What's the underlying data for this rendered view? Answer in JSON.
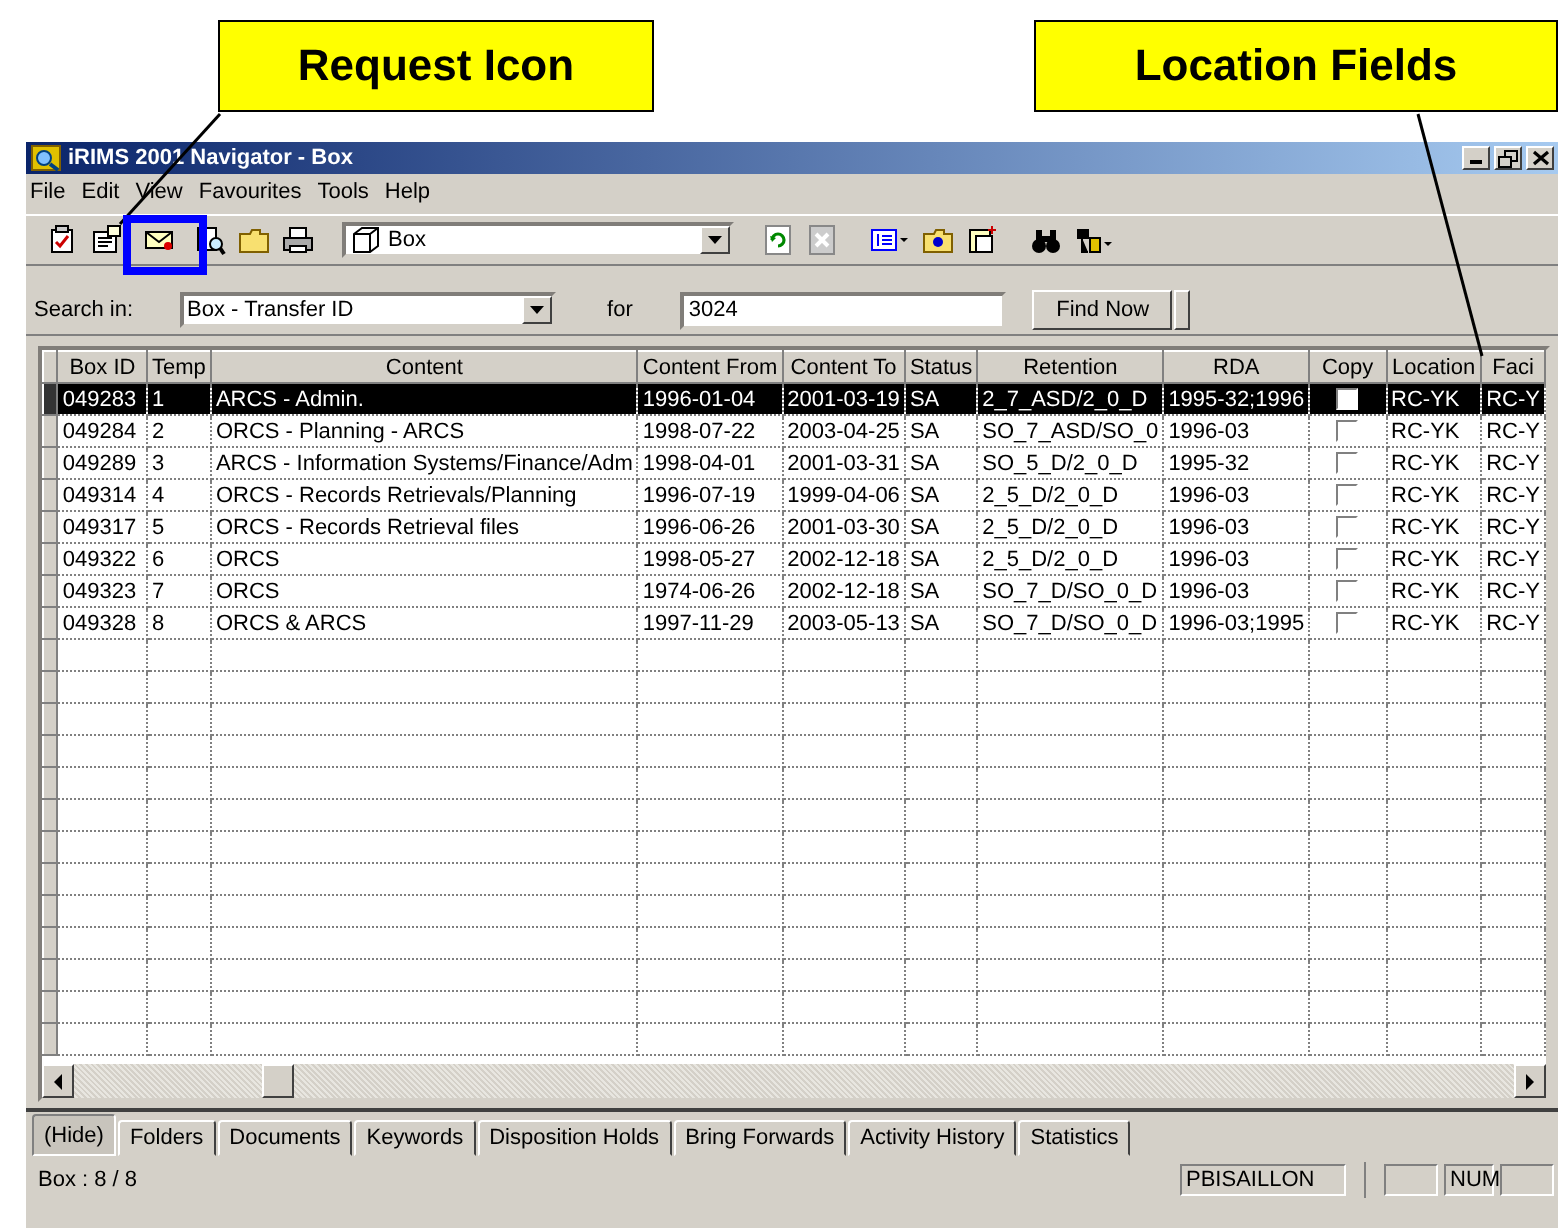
{
  "callouts": [
    {
      "text": "Request Icon"
    },
    {
      "text": "Location Fields"
    }
  ],
  "window": {
    "title": "iRIMS 2001 Navigator - Box"
  },
  "menu": [
    "File",
    "Edit",
    "View",
    "Favourites",
    "Tools",
    "Help"
  ],
  "toolbar": {
    "view_value": "Box"
  },
  "search": {
    "label": "Search in:",
    "field": "Box - Transfer ID",
    "for_label": "for",
    "query": "3024",
    "button": "Find Now"
  },
  "table": {
    "columns": [
      "Box ID",
      "Temp",
      "Content",
      "Content From",
      "Content To",
      "Status",
      "Retention",
      "RDA",
      "Copy",
      "Location",
      "Faci"
    ],
    "rows": [
      {
        "selected": true,
        "copy": false,
        "cells": [
          "049283",
          "1",
          "ARCS - Admin.",
          "1996-01-04",
          "2001-03-19",
          "SA",
          "2_7_ASD/2_0_D",
          "1995-32;1996",
          "",
          "RC-YK",
          "RC-Y"
        ]
      },
      {
        "selected": false,
        "copy": false,
        "cells": [
          "049284",
          "2",
          "ORCS - Planning - ARCS",
          "1998-07-22",
          "2003-04-25",
          "SA",
          "SO_7_ASD/SO_0",
          "1996-03",
          "",
          "RC-YK",
          "RC-Y"
        ]
      },
      {
        "selected": false,
        "copy": false,
        "cells": [
          "049289",
          "3",
          "ARCS - Information Systems/Finance/Adm",
          "1998-04-01",
          "2001-03-31",
          "SA",
          "SO_5_D/2_0_D",
          "1995-32",
          "",
          "RC-YK",
          "RC-Y"
        ]
      },
      {
        "selected": false,
        "copy": false,
        "cells": [
          "049314",
          "4",
          "ORCS - Records Retrievals/Planning",
          "1996-07-19",
          "1999-04-06",
          "SA",
          "2_5_D/2_0_D",
          "1996-03",
          "",
          "RC-YK",
          "RC-Y"
        ]
      },
      {
        "selected": false,
        "copy": false,
        "cells": [
          "049317",
          "5",
          "ORCS - Records Retrieval files",
          "1996-06-26",
          "2001-03-30",
          "SA",
          "2_5_D/2_0_D",
          "1996-03",
          "",
          "RC-YK",
          "RC-Y"
        ]
      },
      {
        "selected": false,
        "copy": false,
        "cells": [
          "049322",
          "6",
          "ORCS",
          "1998-05-27",
          "2002-12-18",
          "SA",
          "2_5_D/2_0_D",
          "1996-03",
          "",
          "RC-YK",
          "RC-Y"
        ]
      },
      {
        "selected": false,
        "copy": false,
        "cells": [
          "049323",
          "7",
          "ORCS",
          "1974-06-26",
          "2002-12-18",
          "SA",
          "SO_7_D/SO_0_D",
          "1996-03",
          "",
          "RC-YK",
          "RC-Y"
        ]
      },
      {
        "selected": false,
        "copy": false,
        "cells": [
          "049328",
          "8",
          "ORCS & ARCS",
          "1997-11-29",
          "2003-05-13",
          "SA",
          "SO_7_D/SO_0_D",
          "1996-03;1995",
          "",
          "RC-YK",
          "RC-Y"
        ]
      }
    ]
  },
  "tabs": [
    {
      "label": "(Hide)",
      "selected": true
    },
    {
      "label": "Folders",
      "selected": false
    },
    {
      "label": "Documents",
      "selected": false
    },
    {
      "label": "Keywords",
      "selected": false
    },
    {
      "label": "Disposition Holds",
      "selected": false
    },
    {
      "label": "Bring Forwards",
      "selected": false
    },
    {
      "label": "Activity History",
      "selected": false
    },
    {
      "label": "Statistics",
      "selected": false
    }
  ],
  "status_bar": {
    "count": "Box : 8 / 8",
    "user": "PBISAILLON",
    "num": "NUM"
  }
}
